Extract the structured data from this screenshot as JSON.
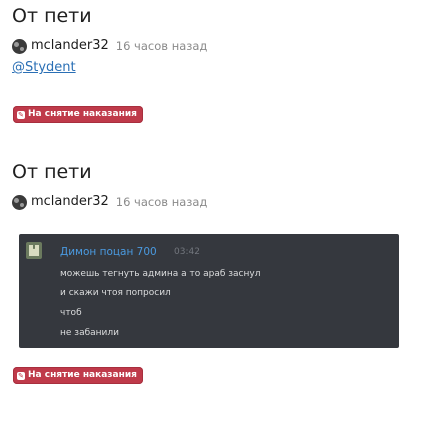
{
  "posts": [
    {
      "title": "От пети",
      "author": "mclander32",
      "time": "16 часов назад",
      "mention": "@Stydent",
      "badge": "На снятие наказания"
    },
    {
      "title": "От пети",
      "author": "mclander32",
      "time": "16 часов назад",
      "badge": "На снятие наказания",
      "embed": {
        "name": "Димон поцан 700",
        "time": "03:42",
        "lines": [
          "можешь тегнуть админа а то араб заснул",
          "и скажи чтоя попросил",
          "чтоб",
          "не забанили"
        ]
      }
    }
  ],
  "colors": {
    "badge": "#bf3a4a",
    "link": "#2a6fb5",
    "discord_bg": "#35383e",
    "discord_name": "#4a9ae0"
  },
  "icons": {
    "badge_icon": "tag-icon",
    "avatar": "user-avatar-icon"
  }
}
